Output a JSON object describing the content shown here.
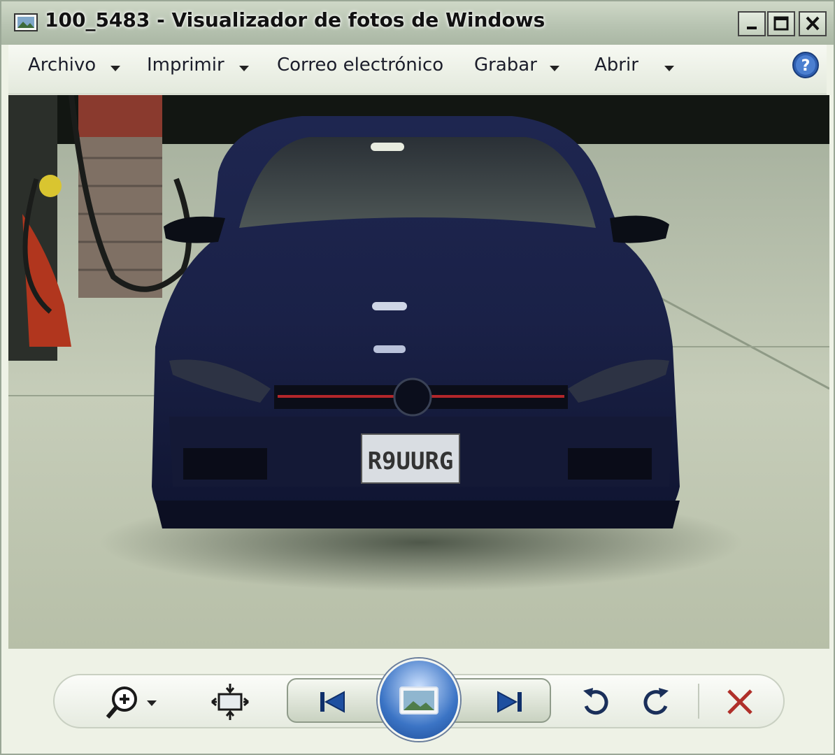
{
  "window": {
    "title": "100_5483 - Visualizador de fotos de Windows"
  },
  "menu": {
    "items": [
      {
        "label": "Archivo",
        "has_dropdown": true
      },
      {
        "label": "Imprimir",
        "has_dropdown": true
      },
      {
        "label": "Correo electrónico",
        "has_dropdown": false
      },
      {
        "label": "Grabar",
        "has_dropdown": true
      },
      {
        "label": "Abrir",
        "has_dropdown": true
      }
    ],
    "help_icon": "help-icon"
  },
  "photo": {
    "plate_text": "R9UURG"
  },
  "toolbar": {
    "icons": [
      "zoom-icon",
      "actual-size-icon",
      "previous-icon",
      "slideshow-icon",
      "next-icon",
      "rotate-left-icon",
      "rotate-right-icon",
      "delete-icon"
    ]
  },
  "colors": {
    "delete": "#b0302a",
    "nav_blue": "#1e4fa0"
  }
}
